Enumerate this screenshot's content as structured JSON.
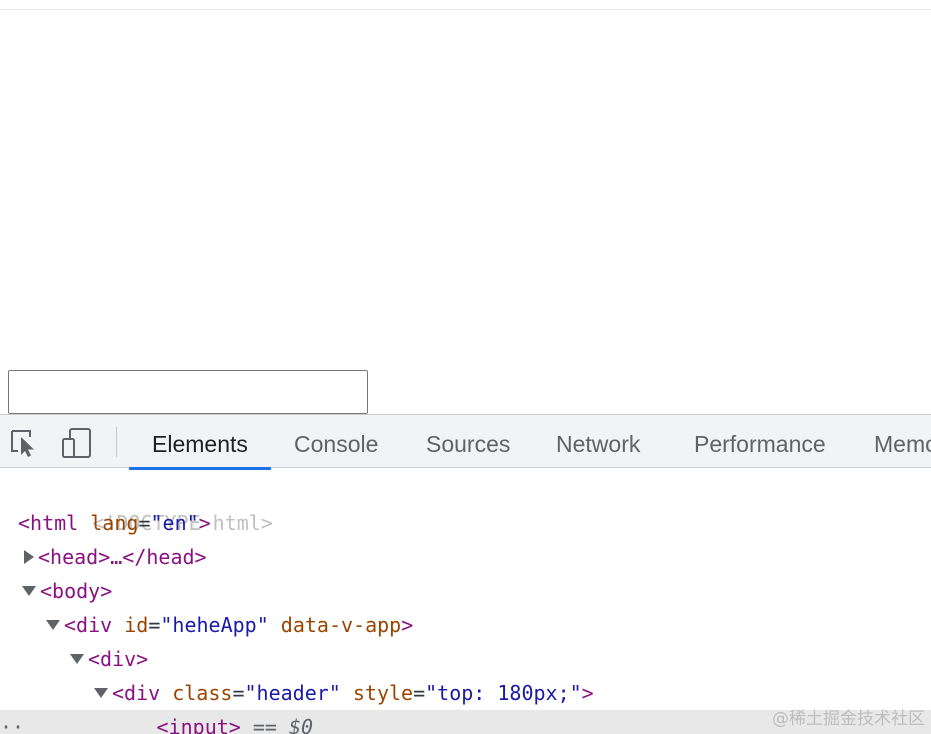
{
  "devtools": {
    "tabs": [
      {
        "label": "Elements",
        "active": true
      },
      {
        "label": "Console",
        "active": false
      },
      {
        "label": "Sources",
        "active": false
      },
      {
        "label": "Network",
        "active": false
      },
      {
        "label": "Performance",
        "active": false
      },
      {
        "label": "Memo",
        "active": false
      }
    ],
    "icons": {
      "inspect": "inspect-element-icon",
      "device": "device-toolbar-icon"
    },
    "accent_color": "#1a73e8"
  },
  "dom_tree": {
    "doctype": "<!DOCTYPE html>",
    "html_open": "<html",
    "html_lang_attr": "lang",
    "html_lang_val": "\"en\"",
    "head_text": "<head>…</head>",
    "body_text": "<body>",
    "div_app_tag": "<div",
    "div_app_id_attr": "id",
    "div_app_id_val": "\"heheApp\"",
    "div_app_extra_attr": "data-v-app",
    "div_plain": "<div>",
    "div_header_tag": "<div",
    "div_header_class_attr": "class",
    "div_header_class_val": "\"header\"",
    "div_header_style_attr": "style",
    "div_header_style_val": "\"top: 180px;\"",
    "input_text": "<input>",
    "selected_marker": "== $0"
  },
  "watermark": "@稀土掘金技术社区"
}
